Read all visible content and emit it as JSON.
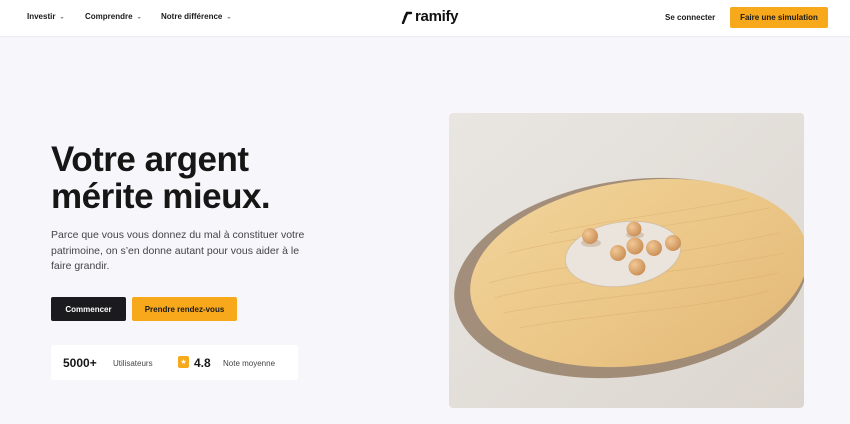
{
  "header": {
    "nav": [
      {
        "label": "Investir"
      },
      {
        "label": "Comprendre"
      },
      {
        "label": "Notre différence"
      }
    ],
    "logo_text": "ramify",
    "login_label": "Se connecter",
    "cta_label": "Faire une simulation"
  },
  "hero": {
    "title_line1": "Votre argent",
    "title_line2": "mérite mieux.",
    "subtitle": "Parce que vous vous donnez du mal à constituer votre patrimoine, on s’en donne autant pour vous aider à le faire grandir.",
    "primary_button": "Commencer",
    "secondary_button": "Prendre rendez-vous"
  },
  "stats": {
    "users_value": "5000+",
    "users_label": "Utilisateurs",
    "rating_value": "4.8",
    "rating_label": "Note moyenne"
  },
  "colors": {
    "accent": "#f7a81b",
    "dark_button": "#1b1b1d",
    "background": "#f7f7fb"
  },
  "icons": {
    "chevron": "chevron-down-icon",
    "logo": "ramify-logo-icon",
    "rating": "star-badge-icon"
  }
}
